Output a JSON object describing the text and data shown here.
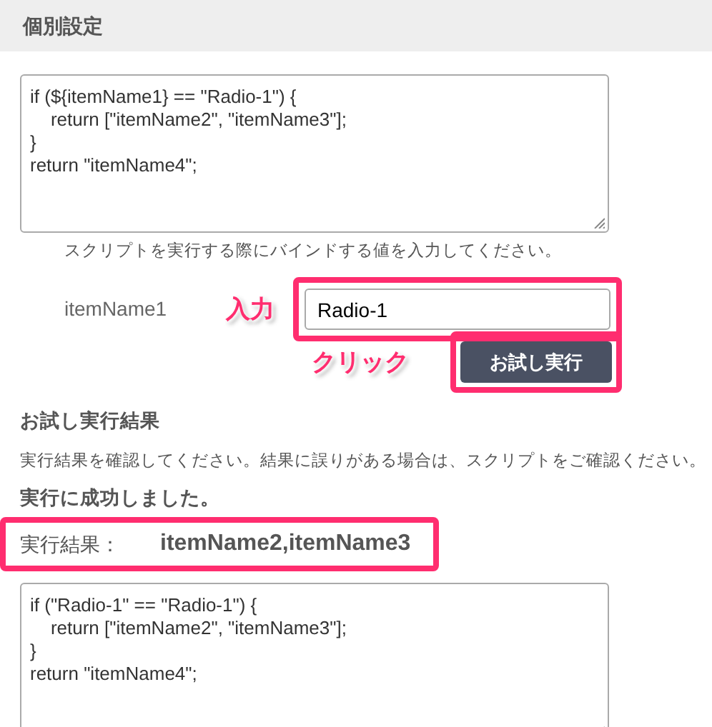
{
  "section_title": "個別設定",
  "script_editor": {
    "value": "if (${itemName1} == \"Radio-1\") {\n    return [\"itemName2\", \"itemName3\"];\n}\nreturn \"itemName4\";"
  },
  "bind_hint": "スクリプトを実行する際にバインドする値を入力してください。",
  "bind_fields": [
    {
      "label": "itemName1",
      "value": "Radio-1"
    }
  ],
  "try_button": "お試し実行",
  "annotations": {
    "input_label": "入力",
    "click_label": "クリック"
  },
  "result": {
    "title": "お試し実行結果",
    "description": "実行結果を確認してください。結果に誤りがある場合は、スクリプトをご確認ください。",
    "status": "実行に成功しました。",
    "result_label": "実行結果：",
    "result_value": "itemName2,itemName3"
  },
  "resolved_script": {
    "value": "if (\"Radio-1\" == \"Radio-1\") {\n    return [\"itemName2\", \"itemName3\"];\n}\nreturn \"itemName4\";"
  }
}
